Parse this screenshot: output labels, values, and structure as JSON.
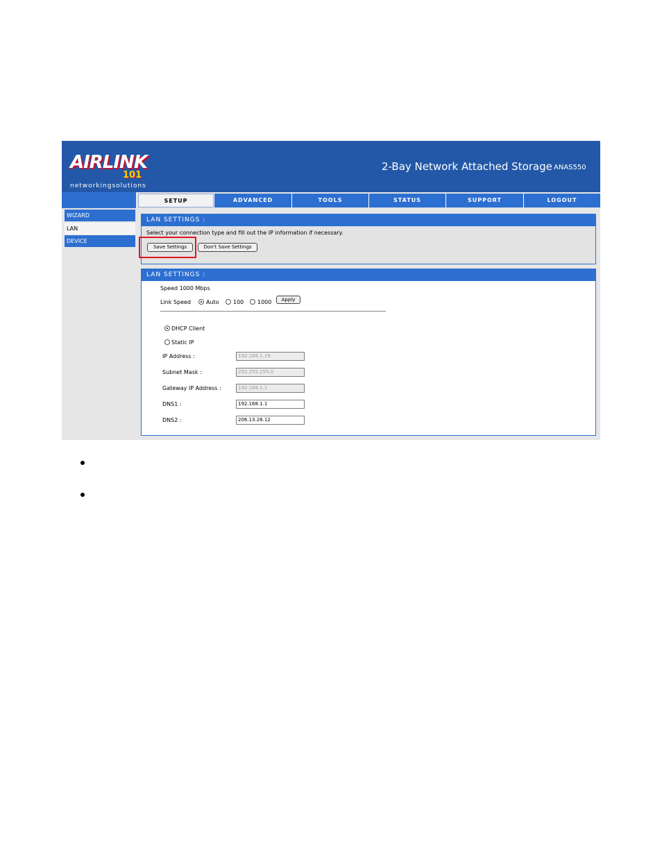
{
  "header": {
    "logo_word": "AIRLINK",
    "logo_number": "101",
    "logo_tagline": "networkingsolutions",
    "product_title": "2-Bay Network Attached Storage",
    "product_model": "ANAS550"
  },
  "nav": {
    "tabs": [
      {
        "label": "SETUP",
        "active": true
      },
      {
        "label": "ADVANCED",
        "active": false
      },
      {
        "label": "TOOLS",
        "active": false
      },
      {
        "label": "STATUS",
        "active": false
      },
      {
        "label": "SUPPORT",
        "active": false
      },
      {
        "label": "LOGOUT",
        "active": false
      }
    ]
  },
  "sidebar": {
    "items": [
      {
        "label": "WIZARD"
      },
      {
        "label": "LAN"
      },
      {
        "label": "DEVICE"
      }
    ]
  },
  "panel1": {
    "title": "LAN SETTINGS :",
    "description": "Select your connection type and fill out the IP information if necessary.",
    "save_label": "Save Settings",
    "dont_save_label": "Don't Save Settings"
  },
  "panel2": {
    "title": "LAN SETTINGS :",
    "speed_text": "Speed 1000 Mbps",
    "link_speed_label": "Link Speed",
    "link_speed_options": [
      "Auto",
      "100",
      "1000"
    ],
    "link_speed_selected": "Auto",
    "apply_label": "Apply",
    "mode_options": [
      "DHCP Client",
      "Static IP"
    ],
    "mode_selected": "DHCP Client",
    "fields": {
      "ip_label": "IP Address :",
      "ip_value": "192.168.1.19",
      "subnet_label": "Subnet Mask :",
      "subnet_value": "255.255.255.0",
      "gateway_label": "Gateway IP Address :",
      "gateway_value": "192.168.1.1",
      "dns1_label": "DNS1 :",
      "dns1_value": "192.168.1.1",
      "dns2_label": "DNS2 :",
      "dns2_value": "206.13.28.12"
    }
  },
  "colors": {
    "header_blue": "#2358a8",
    "nav_blue": "#2d6fd1",
    "highlight_red": "#e0141b"
  }
}
